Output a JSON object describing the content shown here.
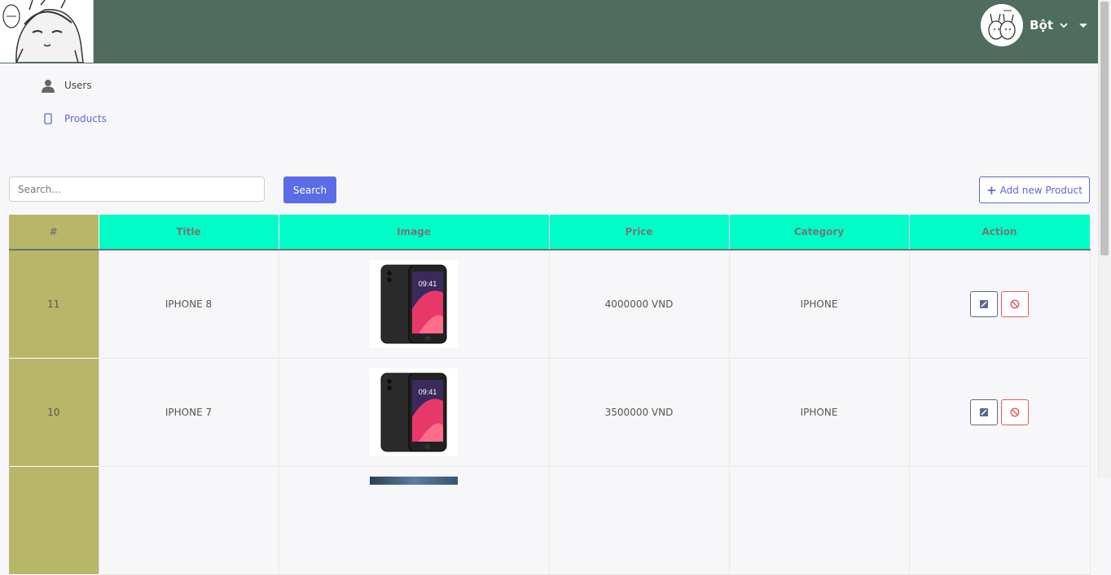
{
  "header": {
    "user_name": "Bột",
    "chevron": "⌄"
  },
  "sidebar": {
    "items": [
      {
        "label": "Users",
        "icon": "user-icon"
      },
      {
        "label": "Products",
        "icon": "phone-icon"
      }
    ]
  },
  "search": {
    "placeholder": "Search...",
    "button_label": "Search"
  },
  "add_button_label": "Add new Product",
  "table": {
    "columns": [
      "#",
      "Title",
      "Image",
      "Price",
      "Category",
      "Action"
    ],
    "rows": [
      {
        "id": "11",
        "title": "IPHONE 8",
        "price": "4000000 VND",
        "category": "IPHONE"
      },
      {
        "id": "10",
        "title": "IPHONE 7",
        "price": "3500000 VND",
        "category": "IPHONE"
      }
    ]
  },
  "colors": {
    "header_bg": "#4e6d5e",
    "table_header": "#00fdc8",
    "id_column": "#b8b769",
    "accent": "#5a6de6"
  }
}
